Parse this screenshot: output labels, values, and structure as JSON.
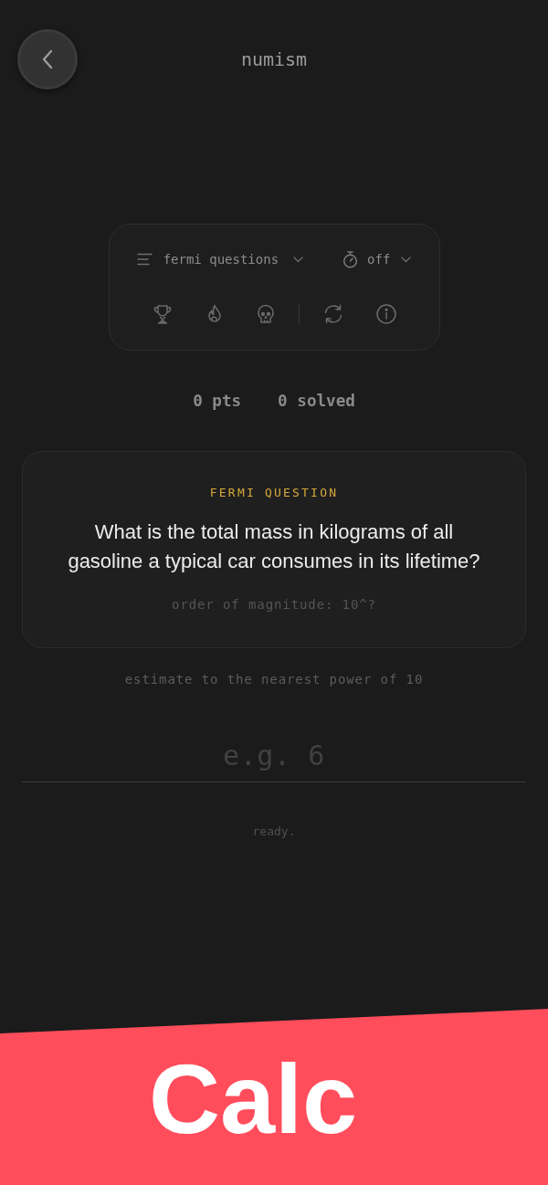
{
  "header": {
    "title": "numism"
  },
  "settings": {
    "mode_dropdown": {
      "label": "fermi questions"
    },
    "timer_dropdown": {
      "label": "off"
    }
  },
  "stats": {
    "points": "0 pts",
    "solved": "0 solved"
  },
  "question_card": {
    "category": "FERMI QUESTION",
    "question": "What is the total mass in kilograms of all gasoline a typical car consumes in its lifetime?",
    "hint": "order of magnitude: 10^?"
  },
  "answer": {
    "instructions": "estimate to the nearest power of 10",
    "placeholder": "e.g. 6",
    "status": "ready."
  },
  "banner": {
    "title": "Calc"
  }
}
